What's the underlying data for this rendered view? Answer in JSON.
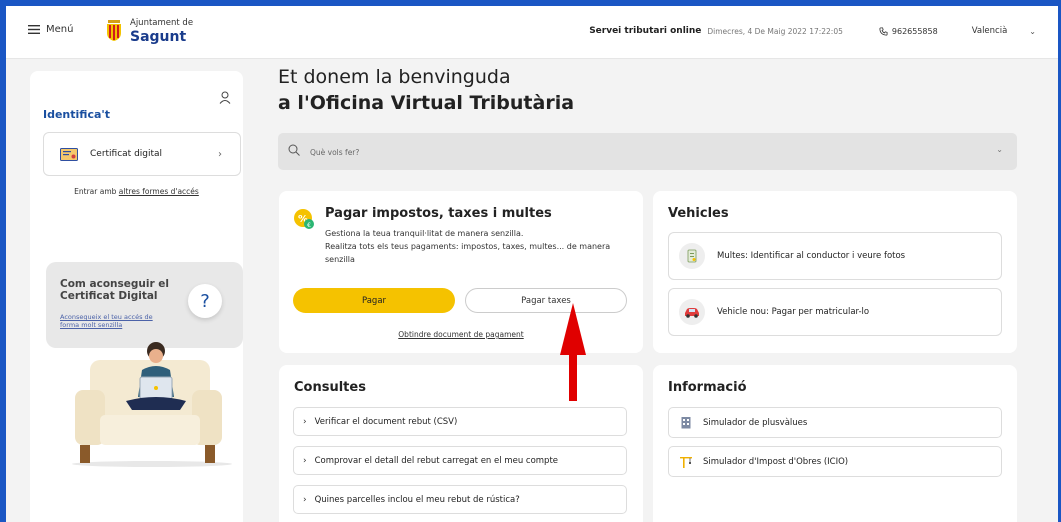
{
  "header": {
    "menu_label": "Menú",
    "logo_small": "Ajuntament de",
    "logo_big": "Sagunt",
    "service": "Servei tributari online",
    "datetime": "Dimecres, 4 De Maig 2022 17:22:05",
    "phone": "962655858",
    "language": "Valencià"
  },
  "sidebar": {
    "identify_title": "Identifica't",
    "cert_label": "Certificat digital",
    "alt_prefix": "Entrar amb ",
    "alt_link": "altres formes d'accés",
    "howto_title": "Com aconseguir el Certificat Digital",
    "howto_link": "Aconsegueix el teu accés de forma molt senzilla"
  },
  "main": {
    "welcome_line1": "Et donem la benvinguda",
    "welcome_line2": "a l'Oficina Virtual Tributària",
    "search_placeholder": "Què vols fer?"
  },
  "payments": {
    "title": "Pagar impostos, taxes i multes",
    "line1": "Gestiona la teua tranquil·litat de manera senzilla.",
    "line2": "Realitza tots els teus pagaments: impostos, taxes, multes... de manera senzilla",
    "pay_button": "Pagar",
    "taxes_button": "Pagar taxes",
    "document_link": "Obtindre document de pagament"
  },
  "vehicles": {
    "title": "Vehicles",
    "items": [
      {
        "label": "Multes: Identificar al conductor i veure fotos"
      },
      {
        "label": "Vehicle nou: Pagar per matricular-lo"
      }
    ]
  },
  "consultes": {
    "title": "Consultes",
    "items": [
      {
        "label": "Verificar el document rebut (CSV)"
      },
      {
        "label": "Comprovar el detall del rebut carregat en el meu compte"
      },
      {
        "label": "Quines parcelles inclou el meu rebut de rústica?"
      }
    ]
  },
  "informacio": {
    "title": "Informació",
    "items": [
      {
        "label": "Simulador de plusvàlues"
      },
      {
        "label": "Simulador d'Impost d'Obres (ICIO)"
      }
    ]
  },
  "colors": {
    "accent_yellow": "#f5c200",
    "brand_blue": "#1a4fa0",
    "annotation_red": "#e00000"
  }
}
